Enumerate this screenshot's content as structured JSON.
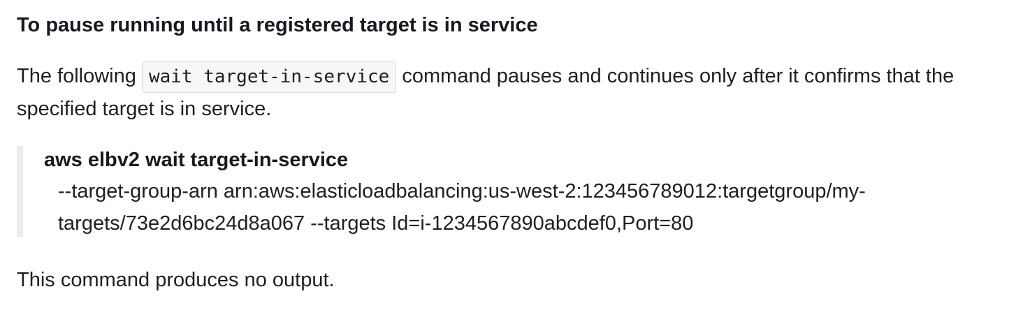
{
  "doc": {
    "heading": "To pause running until a registered target is in service",
    "intro": {
      "before": "The following ",
      "code": "wait target-in-service",
      "after": " command pauses and continues only after it confirms that the specified target is in service."
    },
    "example": {
      "command": "aws elbv2 wait target-in-service",
      "args_lines": [
        "--target-group-arn arn:aws:elasticloadbalancing:us-west-2:123456789012:targetgroup/my-",
        "targets/73e2d6bc24d8a067 --targets Id=i-1234567890abcdef0,Port=80"
      ]
    },
    "outro": "This command produces no output."
  }
}
